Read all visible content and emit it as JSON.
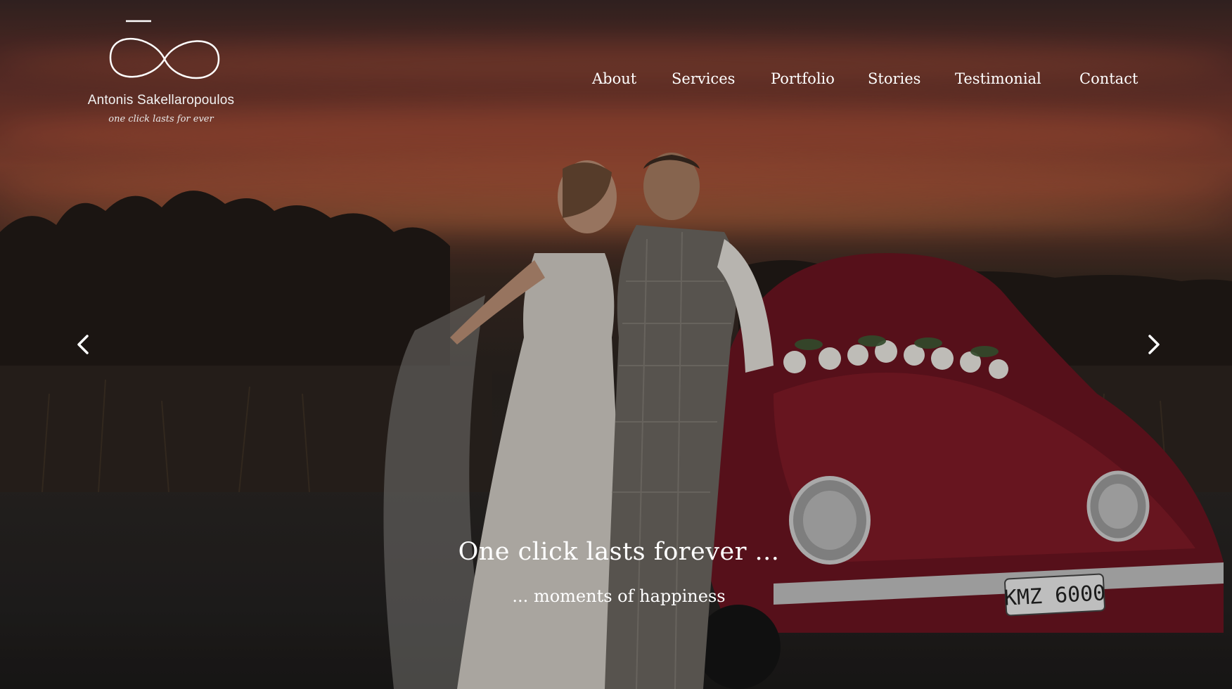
{
  "brand": {
    "name": "Antonis Sakellaropoulos",
    "tagline": "one click lasts for ever",
    "logo_icon": "infinity-loop-logo"
  },
  "nav": {
    "items": [
      {
        "label": "About"
      },
      {
        "label": "Services"
      },
      {
        "label": "Portfolio"
      },
      {
        "label": "Stories"
      },
      {
        "label": "Testimonial"
      },
      {
        "label": "Contact"
      }
    ]
  },
  "slider": {
    "prev_icon": "chevron-left-icon",
    "next_icon": "chevron-right-icon",
    "caption_title": "One click lasts forever ...",
    "caption_subtitle": "... moments of happiness",
    "plate_text": "KMZ 6000"
  },
  "colors": {
    "text": "#ffffff",
    "car_red": "#8a1a24",
    "sky_orange": "#c0523a"
  }
}
